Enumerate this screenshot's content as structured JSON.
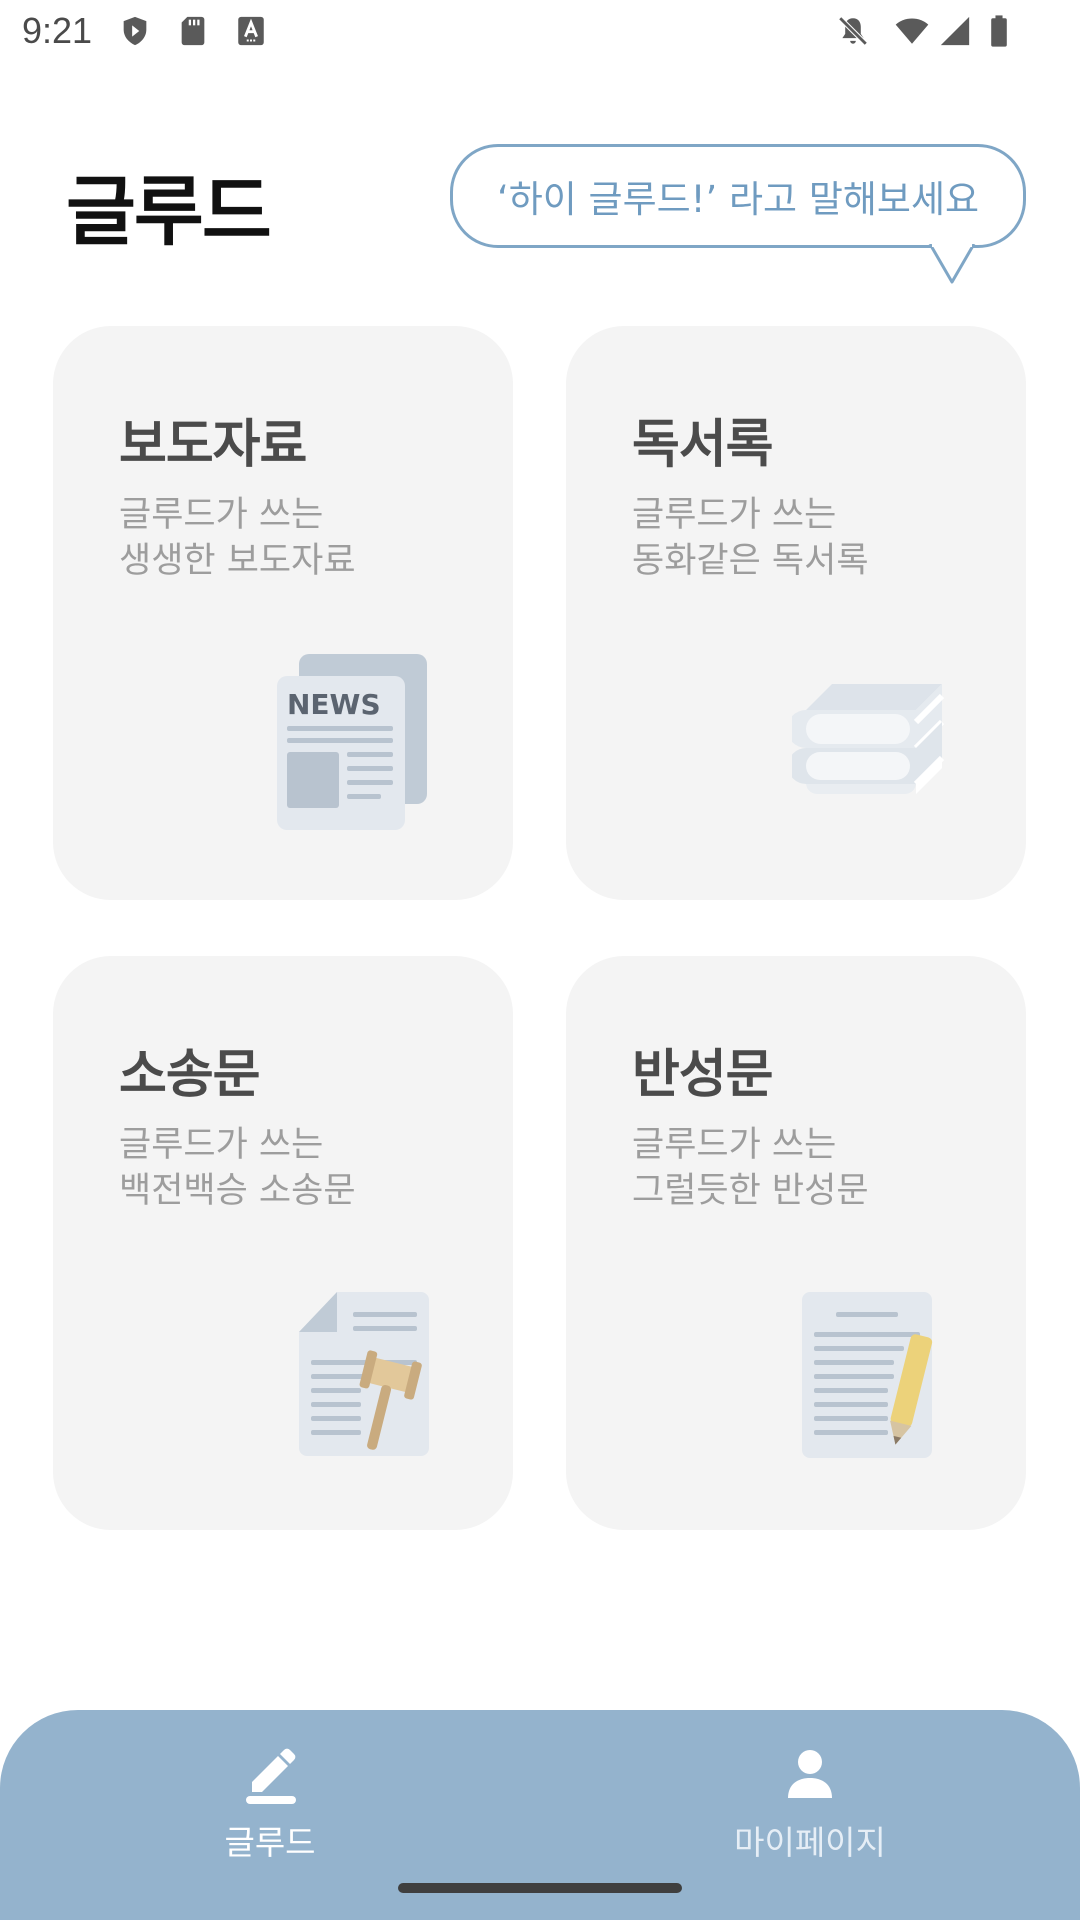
{
  "status_bar": {
    "time": "9:21",
    "left_icons": [
      "shield-icon",
      "sd-card-icon",
      "text-a-icon"
    ],
    "right_icons": [
      "notifications-off-icon",
      "wifi-icon",
      "cellular-signal-icon",
      "battery-icon"
    ]
  },
  "header": {
    "title": "글루드",
    "speech_bubble": "‘하이 글루드!’ 라고 말해보세요"
  },
  "cards": [
    {
      "title": "보도자료",
      "subtitle_line1": "글루드가 쓰는",
      "subtitle_line2": "생생한 보도자료",
      "icon": "newspaper-icon",
      "icon_text": "NEWS"
    },
    {
      "title": "독서록",
      "subtitle_line1": "글루드가 쓰는",
      "subtitle_line2": "동화같은 독서록",
      "icon": "books-icon"
    },
    {
      "title": "소송문",
      "subtitle_line1": "글루드가 쓰는",
      "subtitle_line2": "백전백승 소송문",
      "icon": "document-gavel-icon"
    },
    {
      "title": "반성문",
      "subtitle_line1": "글루드가 쓰는",
      "subtitle_line2": "그럴듯한 반성문",
      "icon": "document-pencil-icon"
    }
  ],
  "bottom_nav": {
    "items": [
      {
        "label": "글루드",
        "icon": "pencil-icon",
        "active": true
      },
      {
        "label": "마이페이지",
        "icon": "person-icon",
        "active": false
      }
    ]
  },
  "colors": {
    "accent": "#94b3cd",
    "bubble_border": "#7fa6c6",
    "bubble_text": "#6f9bc0",
    "card_bg": "#f4f4f4",
    "card_title": "#4b4b4b",
    "card_subtitle": "#9d9d9d"
  }
}
